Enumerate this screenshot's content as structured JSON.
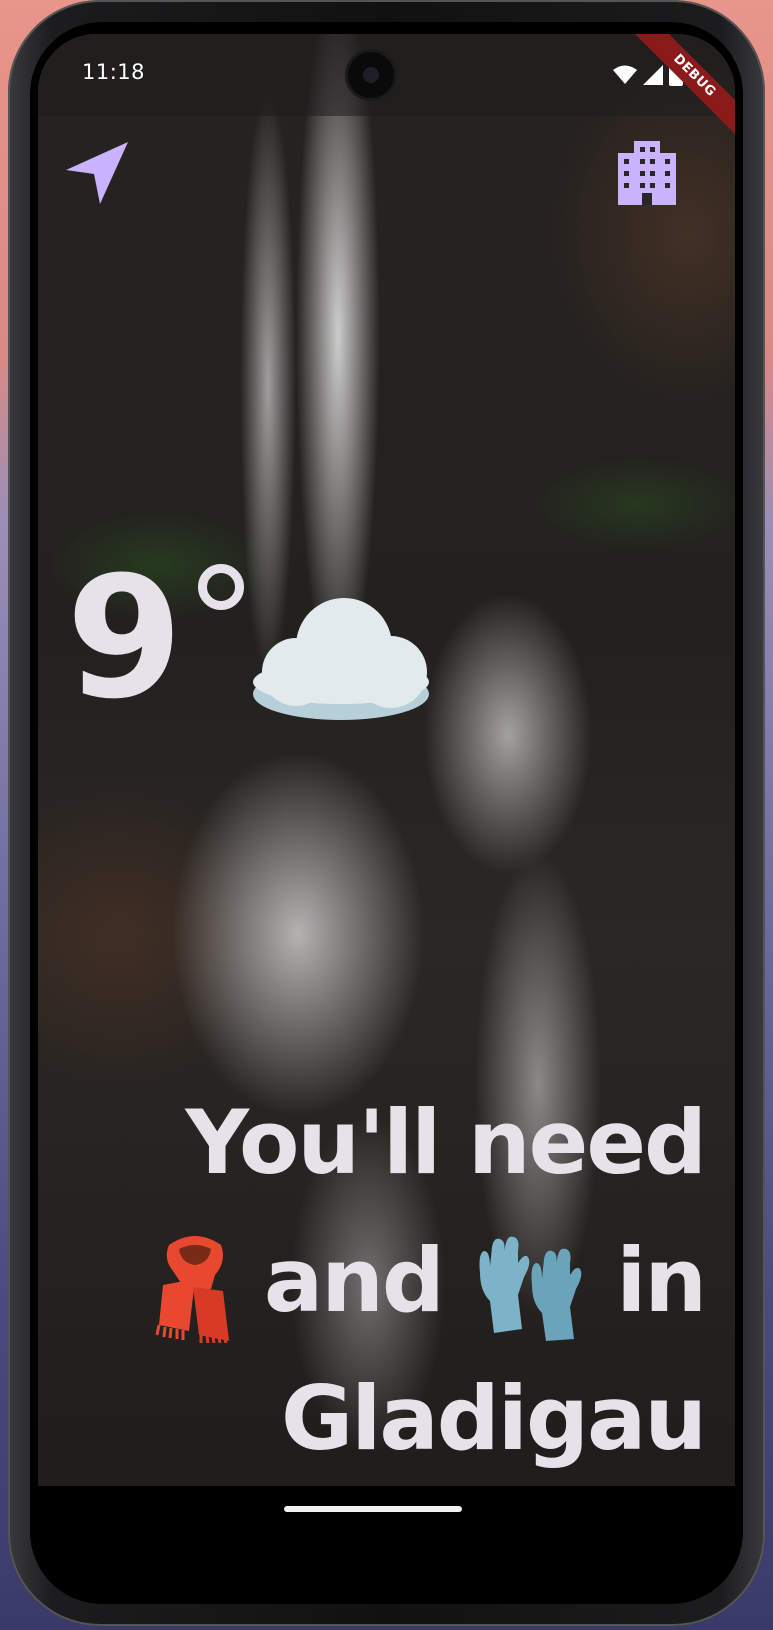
{
  "status_bar": {
    "time": "11:18",
    "icons": [
      "wifi-icon",
      "cellular-signal-icon",
      "battery-icon"
    ],
    "debug_banner": "DEBUG"
  },
  "toolbar": {
    "left_icon": "navigation-arrow-icon",
    "right_icon": "city-building-icon",
    "accent_color": "#c9b3ff"
  },
  "weather": {
    "temperature": "9",
    "condition_icon": "cloud-icon"
  },
  "message": {
    "line1": "You'll need",
    "line2_before": "",
    "line2_and": "and",
    "line2_in": "in",
    "line3": "Gladigau",
    "items": [
      "scarf-icon",
      "gloves-icon"
    ]
  },
  "colors": {
    "text": "#e7e1ea",
    "icon_accent": "#c9b3ff"
  }
}
